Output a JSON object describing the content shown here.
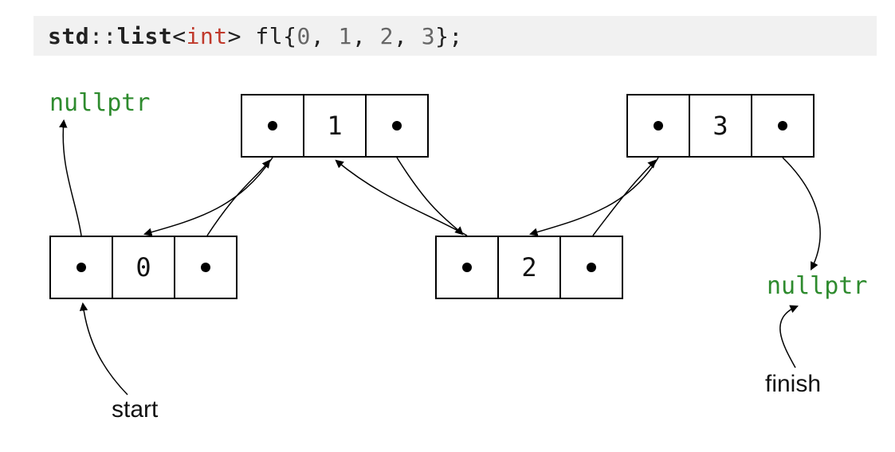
{
  "code": {
    "ns": "std",
    "sep1": "::",
    "container": "list",
    "lt": "<",
    "type": "int",
    "gt": ">",
    "space": " ",
    "ident": "fl",
    "brace_open": "{",
    "v0": "0",
    "comma": ", ",
    "v1": "1",
    "v2": "2",
    "v3": "3",
    "brace_close": "}",
    "semi": ";"
  },
  "nodes": {
    "n0": {
      "value": "0"
    },
    "n1": {
      "value": "1"
    },
    "n2": {
      "value": "2"
    },
    "n3": {
      "value": "3"
    }
  },
  "labels": {
    "null_left": "nullptr",
    "null_right": "nullptr",
    "start": "start",
    "finish": "finish"
  }
}
